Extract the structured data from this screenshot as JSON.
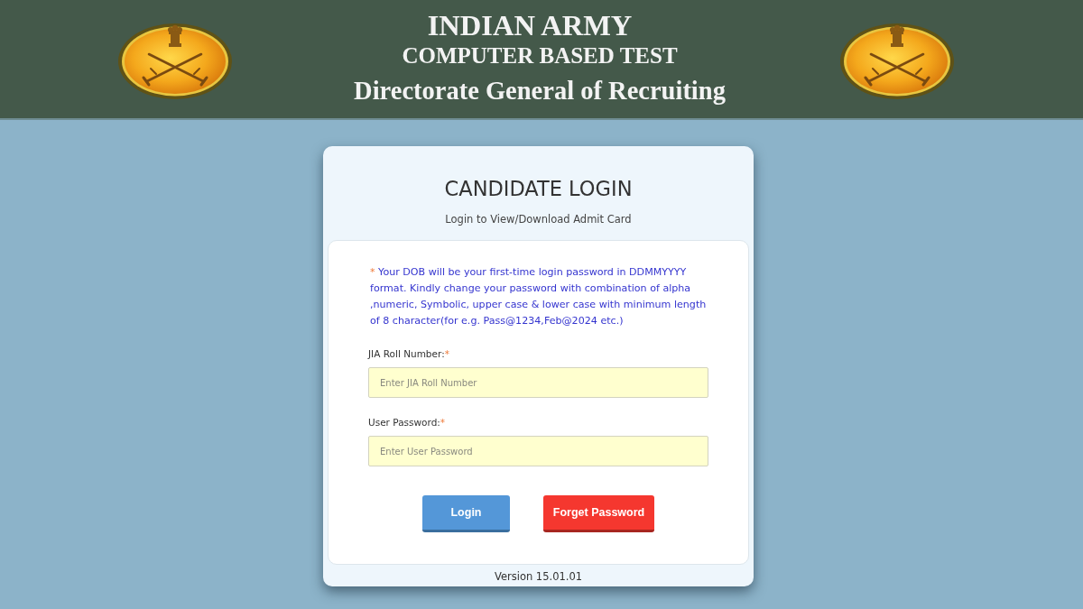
{
  "header": {
    "organisation": "INDIAN ARMY",
    "exam": "COMPUTER BASED TEST",
    "department": "Directorate General of Recruiting"
  },
  "login_card": {
    "title": "CANDIDATE LOGIN",
    "subtitle": "Login to View/Download Admit Card",
    "notice": {
      "marker": "*",
      "text": "Your DOB will be your first-time login password in DDMMYYYY format. Kindly change your password with combination of alpha ,numeric, Symbolic, upper case & lower case with minimum length of 8 character(for e.g. Pass@1234,Feb@2024 etc.)"
    },
    "fields": [
      {
        "label": "JIA Roll Number:",
        "required_mark": "*",
        "placeholder": "Enter JIA Roll Number"
      },
      {
        "label": "User Password:",
        "required_mark": "*",
        "placeholder": "Enter User Password"
      }
    ],
    "buttons": [
      {
        "label": "Login",
        "kind": "primary"
      },
      {
        "label": "Forget Password",
        "kind": "danger"
      }
    ],
    "version": "Version 15.01.01"
  }
}
